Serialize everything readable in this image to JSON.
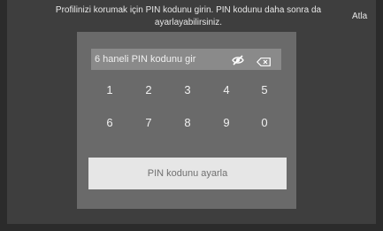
{
  "instruction": "Profilinizi korumak için PIN kodunu girin. PIN kodunu daha sonra da ayarlayabilirsiniz.",
  "skip_label": "Atla",
  "pin_field": {
    "placeholder": "6 haneli PIN kodunu gir",
    "visibility_icon": "eye-off-icon",
    "delete_icon": "backspace-icon"
  },
  "keypad": {
    "row1": [
      "1",
      "2",
      "3",
      "4",
      "5"
    ],
    "row2": [
      "6",
      "7",
      "8",
      "9",
      "0"
    ]
  },
  "submit_label": "PIN kodunu ayarla",
  "colors": {
    "background": "#2b2b2b",
    "panel": "#6a6a6a",
    "field": "#8a8a8a",
    "button": "#e6e6e6",
    "button_text": "#707070",
    "text": "#f0f0f0"
  }
}
